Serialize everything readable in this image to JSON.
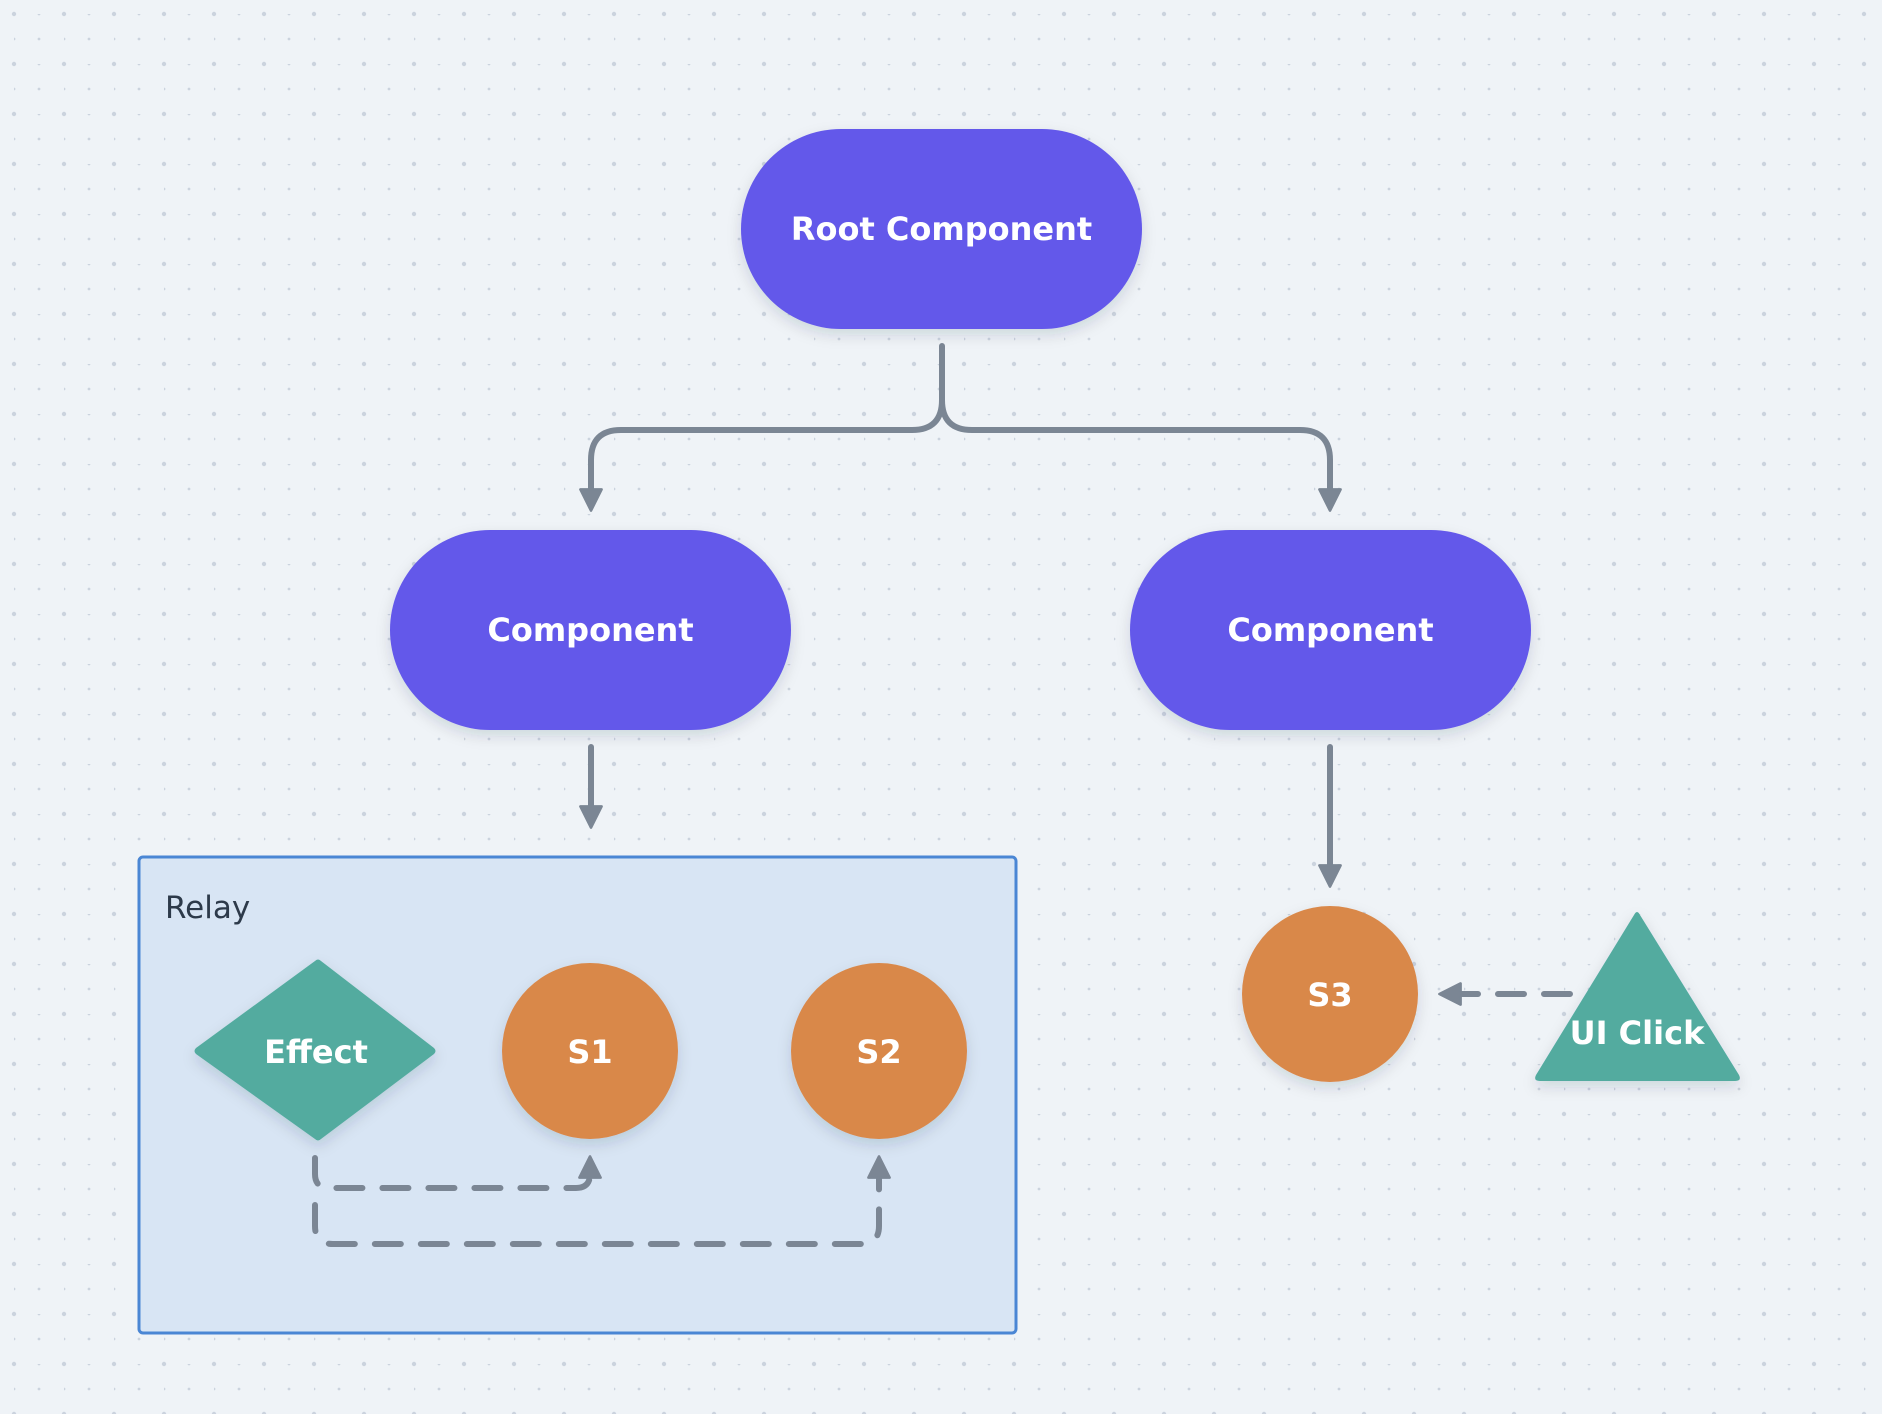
{
  "diagram": {
    "colors": {
      "background": "#eff3f7",
      "grid_dot": "#cbd3de",
      "component": "#6359ea",
      "store": "#d9884a",
      "effect": "#52ab9f",
      "edge": "#7b8694",
      "group_fill": "#d8e5f4",
      "group_border": "#4a86d4",
      "node_text": "#ffffff",
      "group_text": "#2d3a4a"
    },
    "nodes": {
      "root": {
        "label": "Root Component",
        "shape": "pill"
      },
      "component_left": {
        "label": "Component",
        "shape": "pill"
      },
      "component_right": {
        "label": "Component",
        "shape": "pill"
      },
      "effect": {
        "label": "Effect",
        "shape": "diamond"
      },
      "s1": {
        "label": "S1",
        "shape": "circle"
      },
      "s2": {
        "label": "S2",
        "shape": "circle"
      },
      "s3": {
        "label": "S3",
        "shape": "circle"
      },
      "ui_click": {
        "label": "UI Click",
        "shape": "triangle"
      }
    },
    "groups": {
      "relay": {
        "label": "Relay",
        "contains": [
          "effect",
          "s1",
          "s2"
        ]
      }
    },
    "edges": [
      {
        "from": "root",
        "to": "component_left",
        "style": "solid"
      },
      {
        "from": "root",
        "to": "component_right",
        "style": "solid"
      },
      {
        "from": "component_left",
        "to": "relay",
        "style": "solid"
      },
      {
        "from": "component_right",
        "to": "s3",
        "style": "solid"
      },
      {
        "from": "effect",
        "to": "s1",
        "style": "dashed"
      },
      {
        "from": "effect",
        "to": "s2",
        "style": "dashed"
      },
      {
        "from": "ui_click",
        "to": "s3",
        "style": "dashed"
      }
    ]
  }
}
